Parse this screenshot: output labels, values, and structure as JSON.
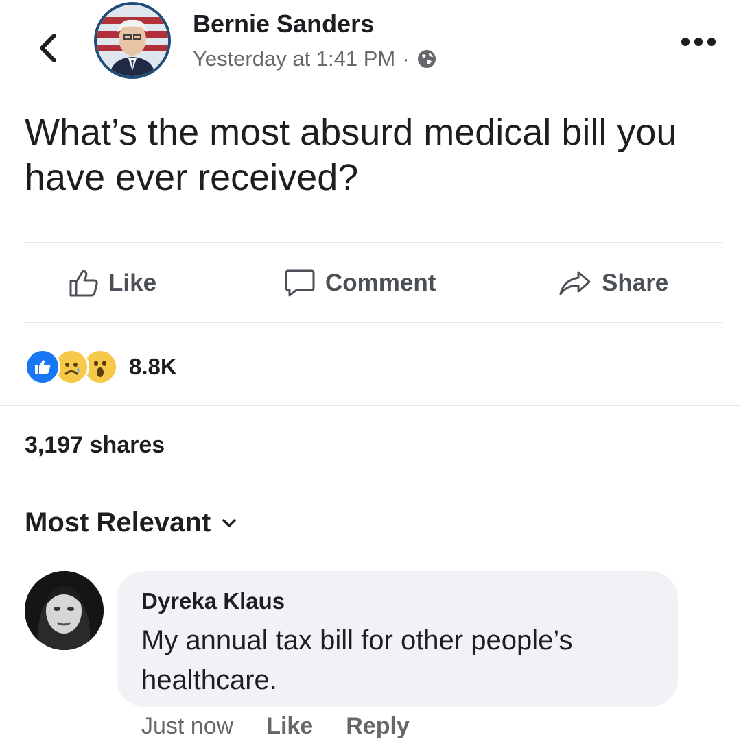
{
  "post": {
    "author": "Bernie Sanders",
    "timestamp": "Yesterday at 1:41 PM",
    "separator": "·",
    "text": "What’s the most absurd medical bill you have ever received?"
  },
  "actions": {
    "like": "Like",
    "comment": "Comment",
    "share": "Share"
  },
  "reactions": {
    "icons": [
      "like-reaction",
      "sad-reaction",
      "wow-reaction"
    ],
    "count": "8.8K"
  },
  "shares": "3,197 shares",
  "sort": {
    "label": "Most Relevant"
  },
  "comment": {
    "author": "Dyreka Klaus",
    "text": "My annual tax bill for other people’s healthcare.",
    "time": "Just now",
    "like": "Like",
    "reply": "Reply"
  },
  "colors": {
    "text": "#1c1e21",
    "muted": "#65676b",
    "like_blue": "#1877f2",
    "bubble": "#f0f2f5"
  }
}
